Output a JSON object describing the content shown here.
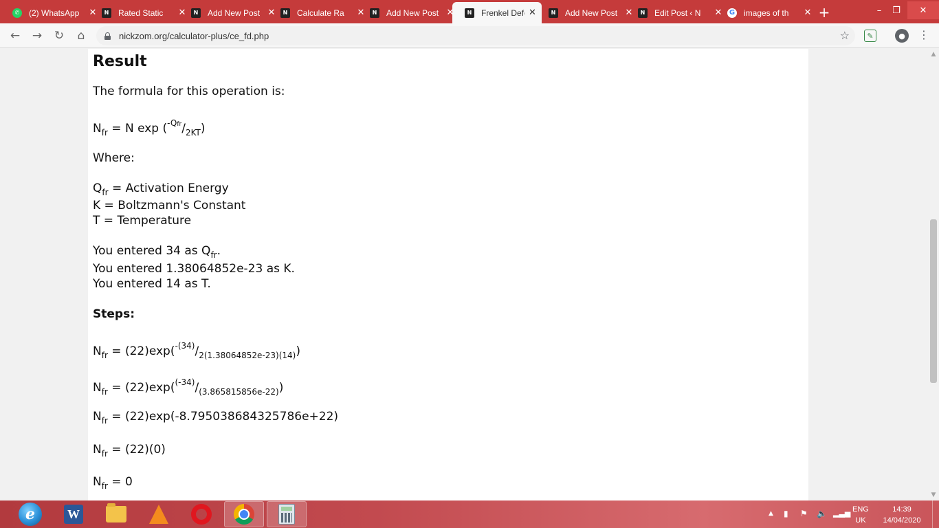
{
  "browser": {
    "tabs": [
      {
        "title": "(2) WhatsApp",
        "icon": "whatsapp-icon"
      },
      {
        "title": "Rated Static",
        "icon": "nickzom-icon"
      },
      {
        "title": "Add New Post",
        "icon": "nickzom-icon"
      },
      {
        "title": "Calculate Ra",
        "icon": "nickzom-icon"
      },
      {
        "title": "Add New Post",
        "icon": "nickzom-icon"
      },
      {
        "title": "Frenkel Defe",
        "icon": "nickzom-icon",
        "active": true
      },
      {
        "title": "Add New Post",
        "icon": "nickzom-icon"
      },
      {
        "title": "Edit Post ‹ N",
        "icon": "nickzom-icon"
      },
      {
        "title": "images of th",
        "icon": "google-icon"
      }
    ],
    "url": "nickzom.org/calculator-plus/ce_fd.php",
    "accent_color": "#c53b3b"
  },
  "page": {
    "result_heading": "Result",
    "formula_intro": "The formula for this operation is:",
    "formula": {
      "lhs": "N",
      "lhs_sub": "fr",
      "rhs_prefix": " = N exp (",
      "num_sign": "-",
      "num": "Q",
      "num_sub": "fr",
      "den": "2KT",
      "close": ")"
    },
    "where_label": "Where:",
    "definitions": [
      {
        "sym": "Q",
        "sym_sub": "fr",
        "desc": " = Activation Energy"
      },
      {
        "sym": "K",
        "sym_sub": "",
        "desc": " = Boltzmann's Constant"
      },
      {
        "sym": "T",
        "sym_sub": "",
        "desc": " = Temperature"
      }
    ],
    "entered": [
      {
        "text": "You entered 34 as Q",
        "sub": "fr",
        "end": "."
      },
      {
        "text": "You entered 1.38064852e-23 as K.",
        "sub": "",
        "end": ""
      },
      {
        "text": "You entered 14 as T.",
        "sub": "",
        "end": ""
      }
    ],
    "steps_label": "Steps:",
    "steps": [
      {
        "prefix": " = (22)exp(",
        "num": "-(34)",
        "den": "2(1.38064852e-23)(14)",
        "close": ")"
      },
      {
        "prefix": " = (22)exp(",
        "num": "(-34)",
        "den": "(3.865815856e-22)",
        "close": ")"
      },
      {
        "text": " = (22)exp(-8.795038684325786e+22)"
      },
      {
        "text": " = (22)(0)"
      },
      {
        "text": " = 0"
      }
    ],
    "symbol_N": "N",
    "symbol_fr": "fr"
  },
  "taskbar": {
    "apps": [
      "internet-explorer-icon",
      "word-icon",
      "file-explorer-icon",
      "vlc-icon",
      "opera-icon",
      "chrome-icon",
      "calculator-icon"
    ],
    "lang_line1": "ENG",
    "lang_line2": "UK",
    "time": "14:39",
    "date": "14/04/2020"
  }
}
